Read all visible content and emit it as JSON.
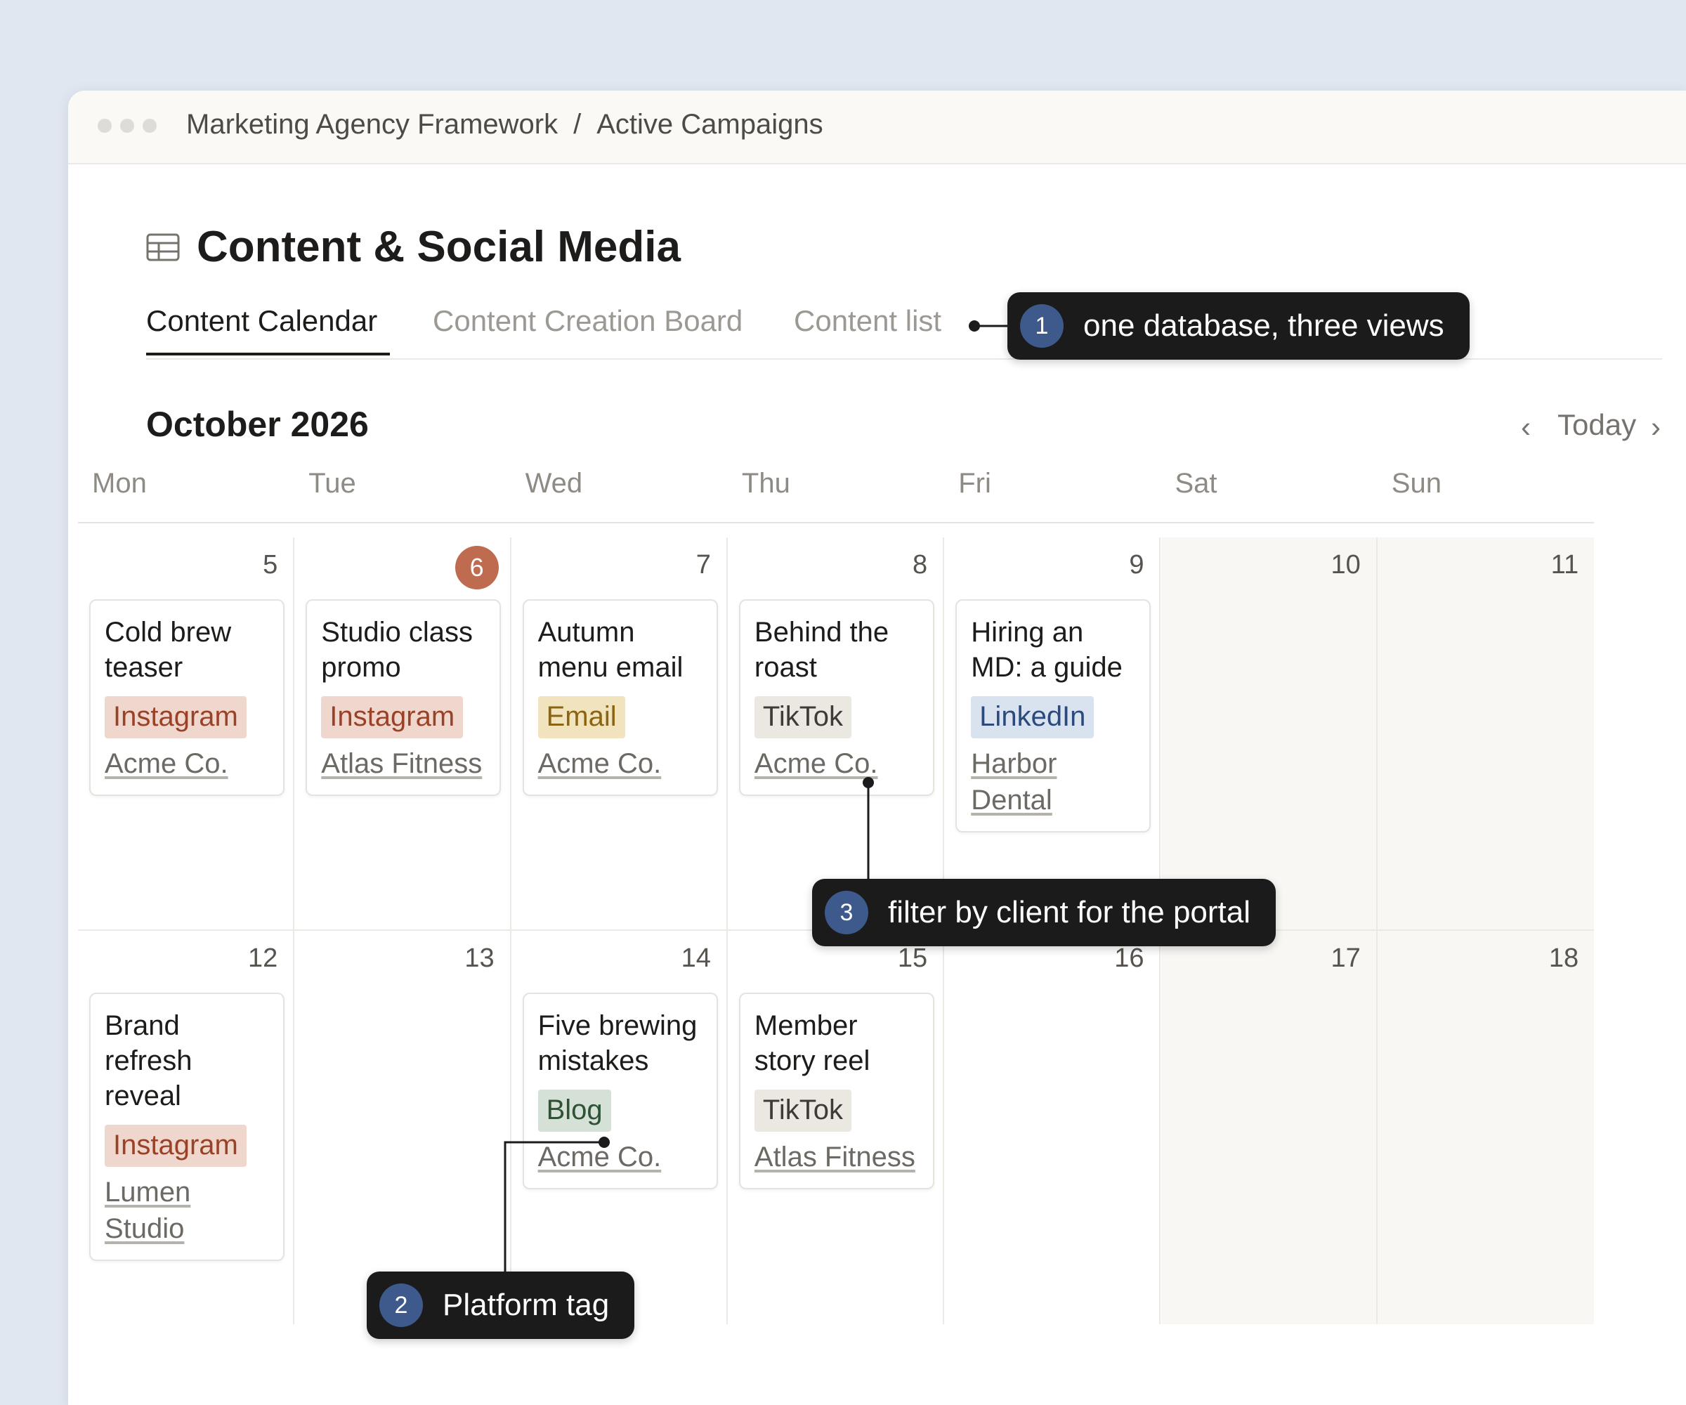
{
  "breadcrumb": [
    "Marketing Agency Framework",
    "Active Campaigns"
  ],
  "breadcrumb_separator": "/",
  "page": {
    "title": "Content & Social Media",
    "icon": "table-icon"
  },
  "tabs": [
    {
      "label": "Content Calendar",
      "active": true
    },
    {
      "label": "Content Creation Board",
      "active": false
    },
    {
      "label": "Content list",
      "active": false
    }
  ],
  "calendar": {
    "month_label": "October 2026",
    "nav": {
      "prev": "‹",
      "today": "Today",
      "next": "›"
    },
    "weekdays": [
      "Mon",
      "Tue",
      "Wed",
      "Thu",
      "Fri",
      "Sat",
      "Sun"
    ],
    "today": 6,
    "weeks": [
      [
        "5",
        "6",
        "7",
        "8",
        "9",
        "10",
        "11"
      ],
      [
        "12",
        "13",
        "14",
        "15",
        "16",
        "17",
        "18"
      ]
    ],
    "items": [
      {
        "title": "Cold brew teaser",
        "platform": "Instagram",
        "client": "Acme Co.",
        "date": 5
      },
      {
        "title": "Studio class promo",
        "platform": "Instagram",
        "client": "Atlas Fitness",
        "date": 6
      },
      {
        "title": "Autumn menu email",
        "platform": "Email",
        "client": "Acme Co.",
        "date": 7
      },
      {
        "title": "Behind the roast",
        "platform": "TikTok",
        "client": "Acme Co.",
        "date": 8
      },
      {
        "title": "Hiring an MD: a guide",
        "platform": "LinkedIn",
        "client": "Harbor Dental",
        "date": 9
      },
      {
        "title": "Brand refresh reveal",
        "platform": "Instagram",
        "client": "Lumen Studio",
        "date": 12
      },
      {
        "title": "Five brewing mistakes",
        "platform": "Blog",
        "client": "Acme Co.",
        "date": 14
      },
      {
        "title": "Member story reel",
        "platform": "TikTok",
        "client": "Atlas Fitness",
        "date": 15
      }
    ]
  },
  "platform_colors": {
    "Instagram": {
      "bg": "#f0d7cd",
      "fg": "#9a4228"
    },
    "Email": {
      "bg": "#f2e3bf",
      "fg": "#8a6410"
    },
    "TikTok": {
      "bg": "#ebe8e2",
      "fg": "#3e3b37"
    },
    "LinkedIn": {
      "bg": "#d9e2ef",
      "fg": "#2b4a7a"
    },
    "Blog": {
      "bg": "#d5e1d6",
      "fg": "#2e5236"
    }
  },
  "callouts": [
    {
      "number": "1",
      "text": "one database, three views"
    },
    {
      "number": "2",
      "text": "Platform tag"
    },
    {
      "number": "3",
      "text": "filter by client for the portal"
    }
  ],
  "colors": {
    "accent_today": "#bf6b4f",
    "callout_bg": "#1b1b1b",
    "callout_badge": "#3e5a8c",
    "page_bg": "#e1e7f0"
  }
}
